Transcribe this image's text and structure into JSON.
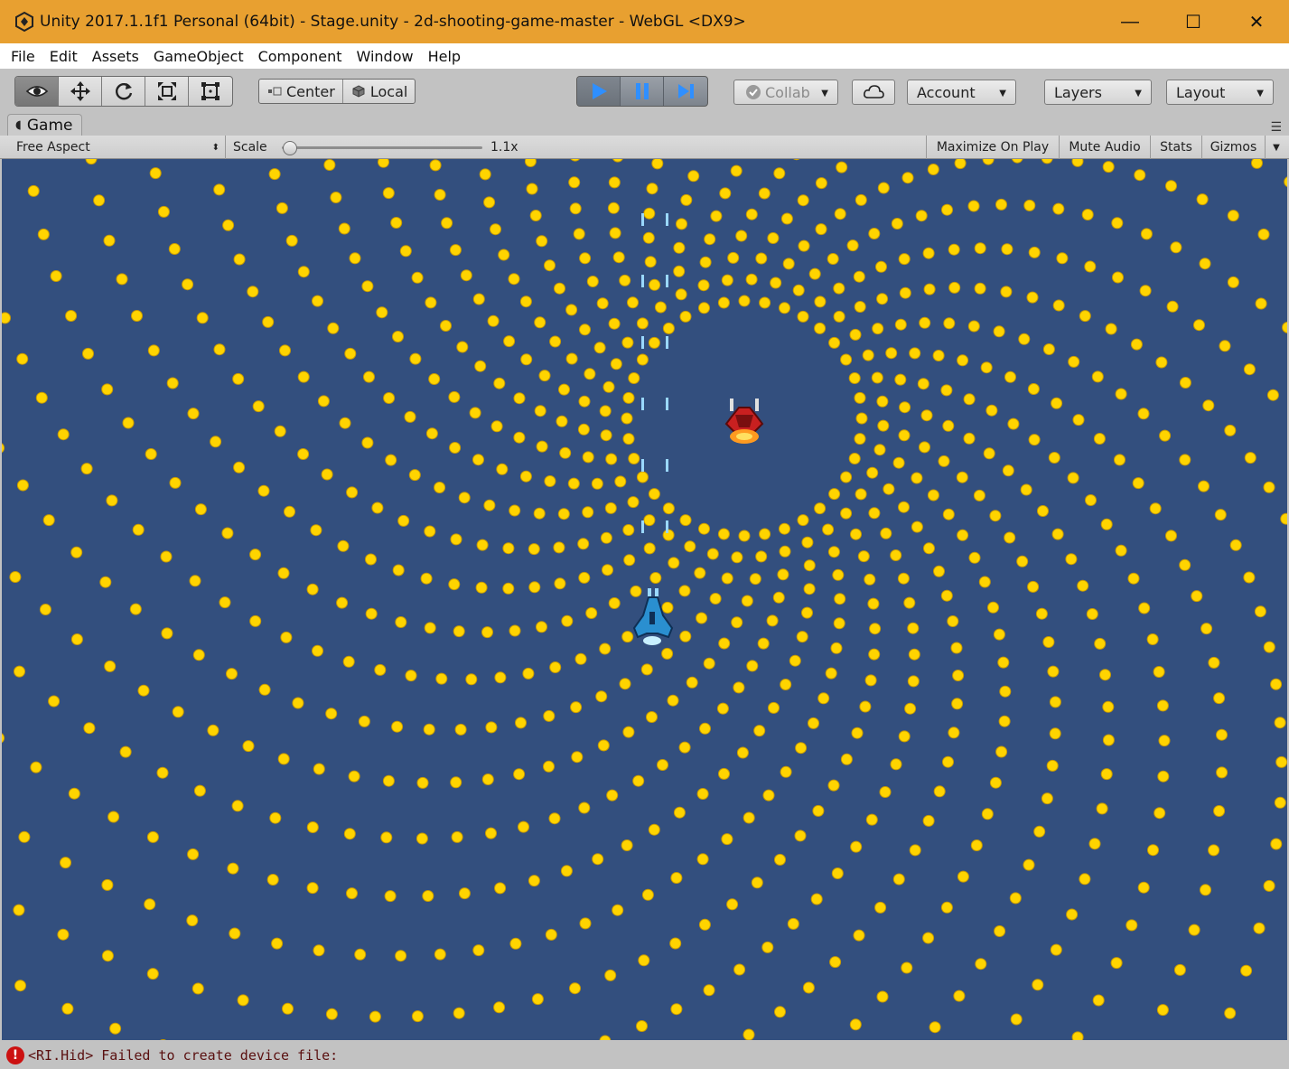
{
  "window": {
    "title": "Unity 2017.1.1f1 Personal (64bit) - Stage.unity - 2d-shooting-game-master - WebGL <DX9>",
    "minimize_glyph": "—",
    "maximize_glyph": "☐",
    "close_glyph": "✕"
  },
  "menu": {
    "items": [
      "File",
      "Edit",
      "Assets",
      "GameObject",
      "Component",
      "Window",
      "Help"
    ]
  },
  "toolbar": {
    "transform_tools": [
      "view-tool",
      "move-tool",
      "rotate-tool",
      "scale-tool",
      "rect-tool"
    ],
    "active_tool": "view-tool",
    "pivot_mode": "Center",
    "pivot_rotation": "Local",
    "play_controls": [
      "play",
      "pause",
      "step"
    ],
    "collab_label": "Collab",
    "account_label": "Account",
    "layers_label": "Layers",
    "layout_label": "Layout",
    "accent_color": "#2f8fff"
  },
  "game_panel": {
    "tab_label": "Game",
    "aspect": "Free Aspect",
    "scale_label": "Scale",
    "scale_value": "1.1x",
    "scale_fraction": 0.0,
    "maximize_on_play": "Maximize On Play",
    "mute_audio": "Mute Audio",
    "stats": "Stats",
    "gizmos": "Gizmos"
  },
  "scene": {
    "background_color": "#334f7e",
    "bullet_color": "#ffd400",
    "enemy_color": "#c82020",
    "player_color": "#2a8fd0",
    "pattern": "spiral bullet hell",
    "spiral_arms": 36
  },
  "console": {
    "message": "<RI.Hid> Failed to create device file:",
    "severity": "error"
  }
}
